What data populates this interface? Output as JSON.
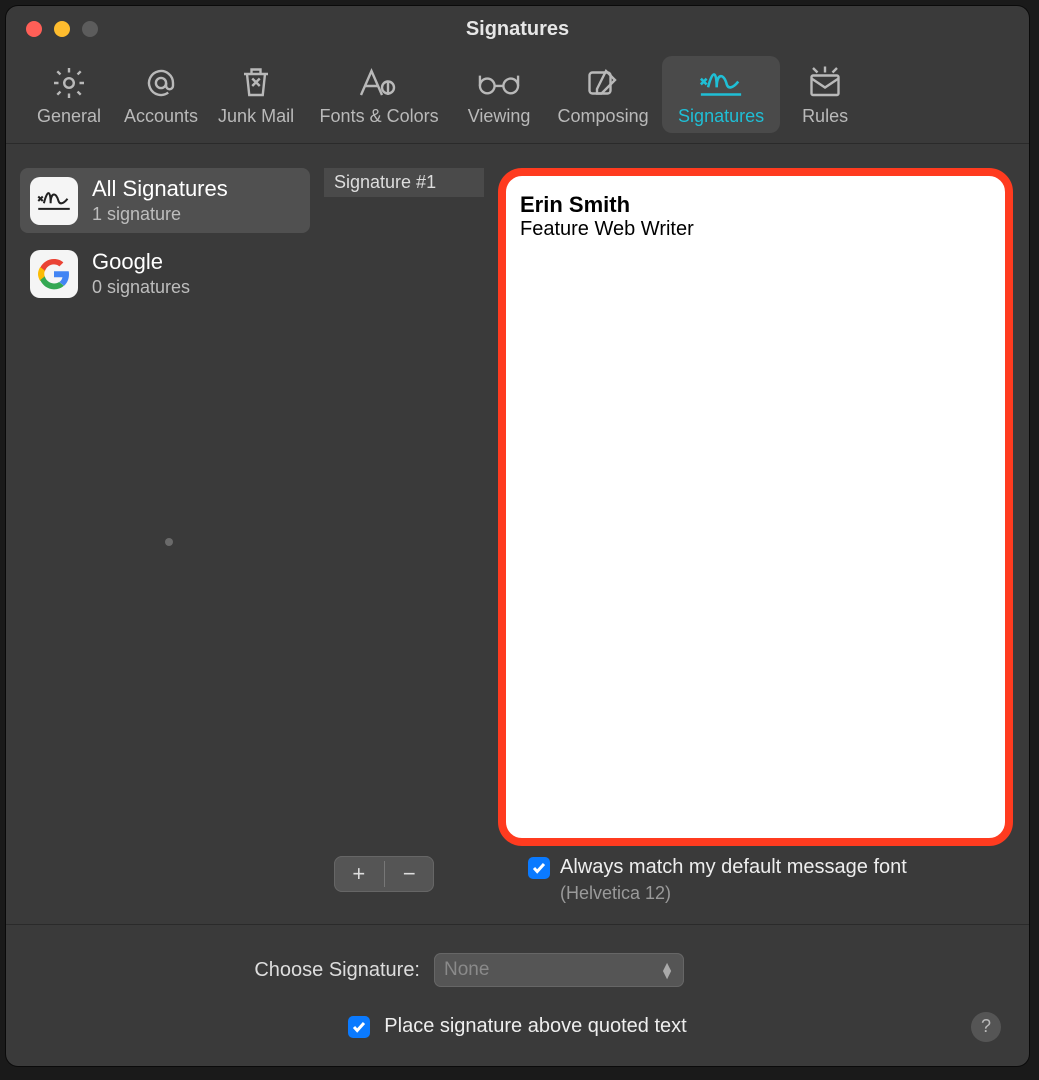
{
  "window": {
    "title": "Signatures"
  },
  "toolbar": {
    "items": [
      {
        "label": "General"
      },
      {
        "label": "Accounts"
      },
      {
        "label": "Junk Mail"
      },
      {
        "label": "Fonts & Colors"
      },
      {
        "label": "Viewing"
      },
      {
        "label": "Composing"
      },
      {
        "label": "Signatures"
      },
      {
        "label": "Rules"
      }
    ]
  },
  "sidebar": {
    "items": [
      {
        "name": "All Signatures",
        "sub": "1 signature"
      },
      {
        "name": "Google",
        "sub": "0 signatures"
      }
    ]
  },
  "siglist": {
    "items": [
      {
        "label": "Signature #1"
      }
    ]
  },
  "editor": {
    "line1": "Erin Smith",
    "line2": "Feature Web Writer"
  },
  "matchfont": {
    "label": "Always match my default message font",
    "hint": "(Helvetica 12)"
  },
  "choose": {
    "label": "Choose Signature:",
    "value": "None"
  },
  "place_above": "Place signature above quoted text",
  "help": "?"
}
